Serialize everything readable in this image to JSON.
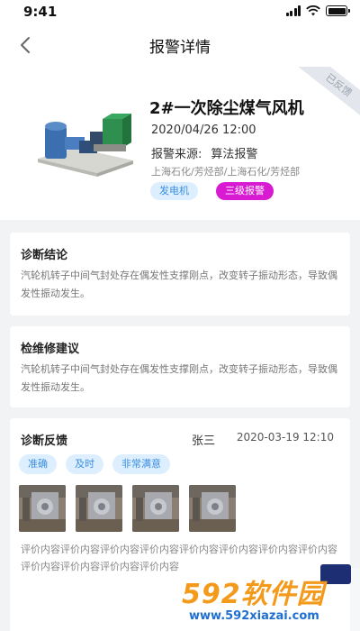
{
  "status_bar": {
    "time": "9:41"
  },
  "nav": {
    "title": "报警详情"
  },
  "header": {
    "ribbon": "已反馈",
    "device_name": "2#一次除尘煤气风机",
    "alarm_time": "2020/04/26 12:00",
    "source_label": "报警来源:",
    "source_value": "算法报警",
    "org_path": "上海石化/芳烃部/上海石化/芳烃部",
    "tag_type": "发电机",
    "tag_level": "三级报警",
    "colors": {
      "tag_type_bg": "#ddeefe",
      "tag_type_fg": "#3a8fe0",
      "tag_level_bg": "#d81bd3"
    }
  },
  "diagnosis": {
    "title": "诊断结论",
    "body": "汽轮机转子中间气封处存在偶发性支撑刚点，改变转子振动形态，导致偶发性振动发生。"
  },
  "repair": {
    "title": "检维修建议",
    "body": "汽轮机转子中间气封处存在偶发性支撑刚点，改变转子振动形态，导致偶发性振动发生。"
  },
  "feedback": {
    "title": "诊断反馈",
    "person": "张三",
    "time": "2020-03-19 12:10",
    "chips": [
      "准确",
      "及时",
      "非常满意"
    ],
    "photo_count": 4,
    "comment": "评价内容评价内容评价内容评价内容评价内容评价内容评价内容评价内容评价内容评价内容评价内容评价内容"
  },
  "watermark": {
    "logo": "592软件园",
    "url": "www.592xiazai.com"
  }
}
